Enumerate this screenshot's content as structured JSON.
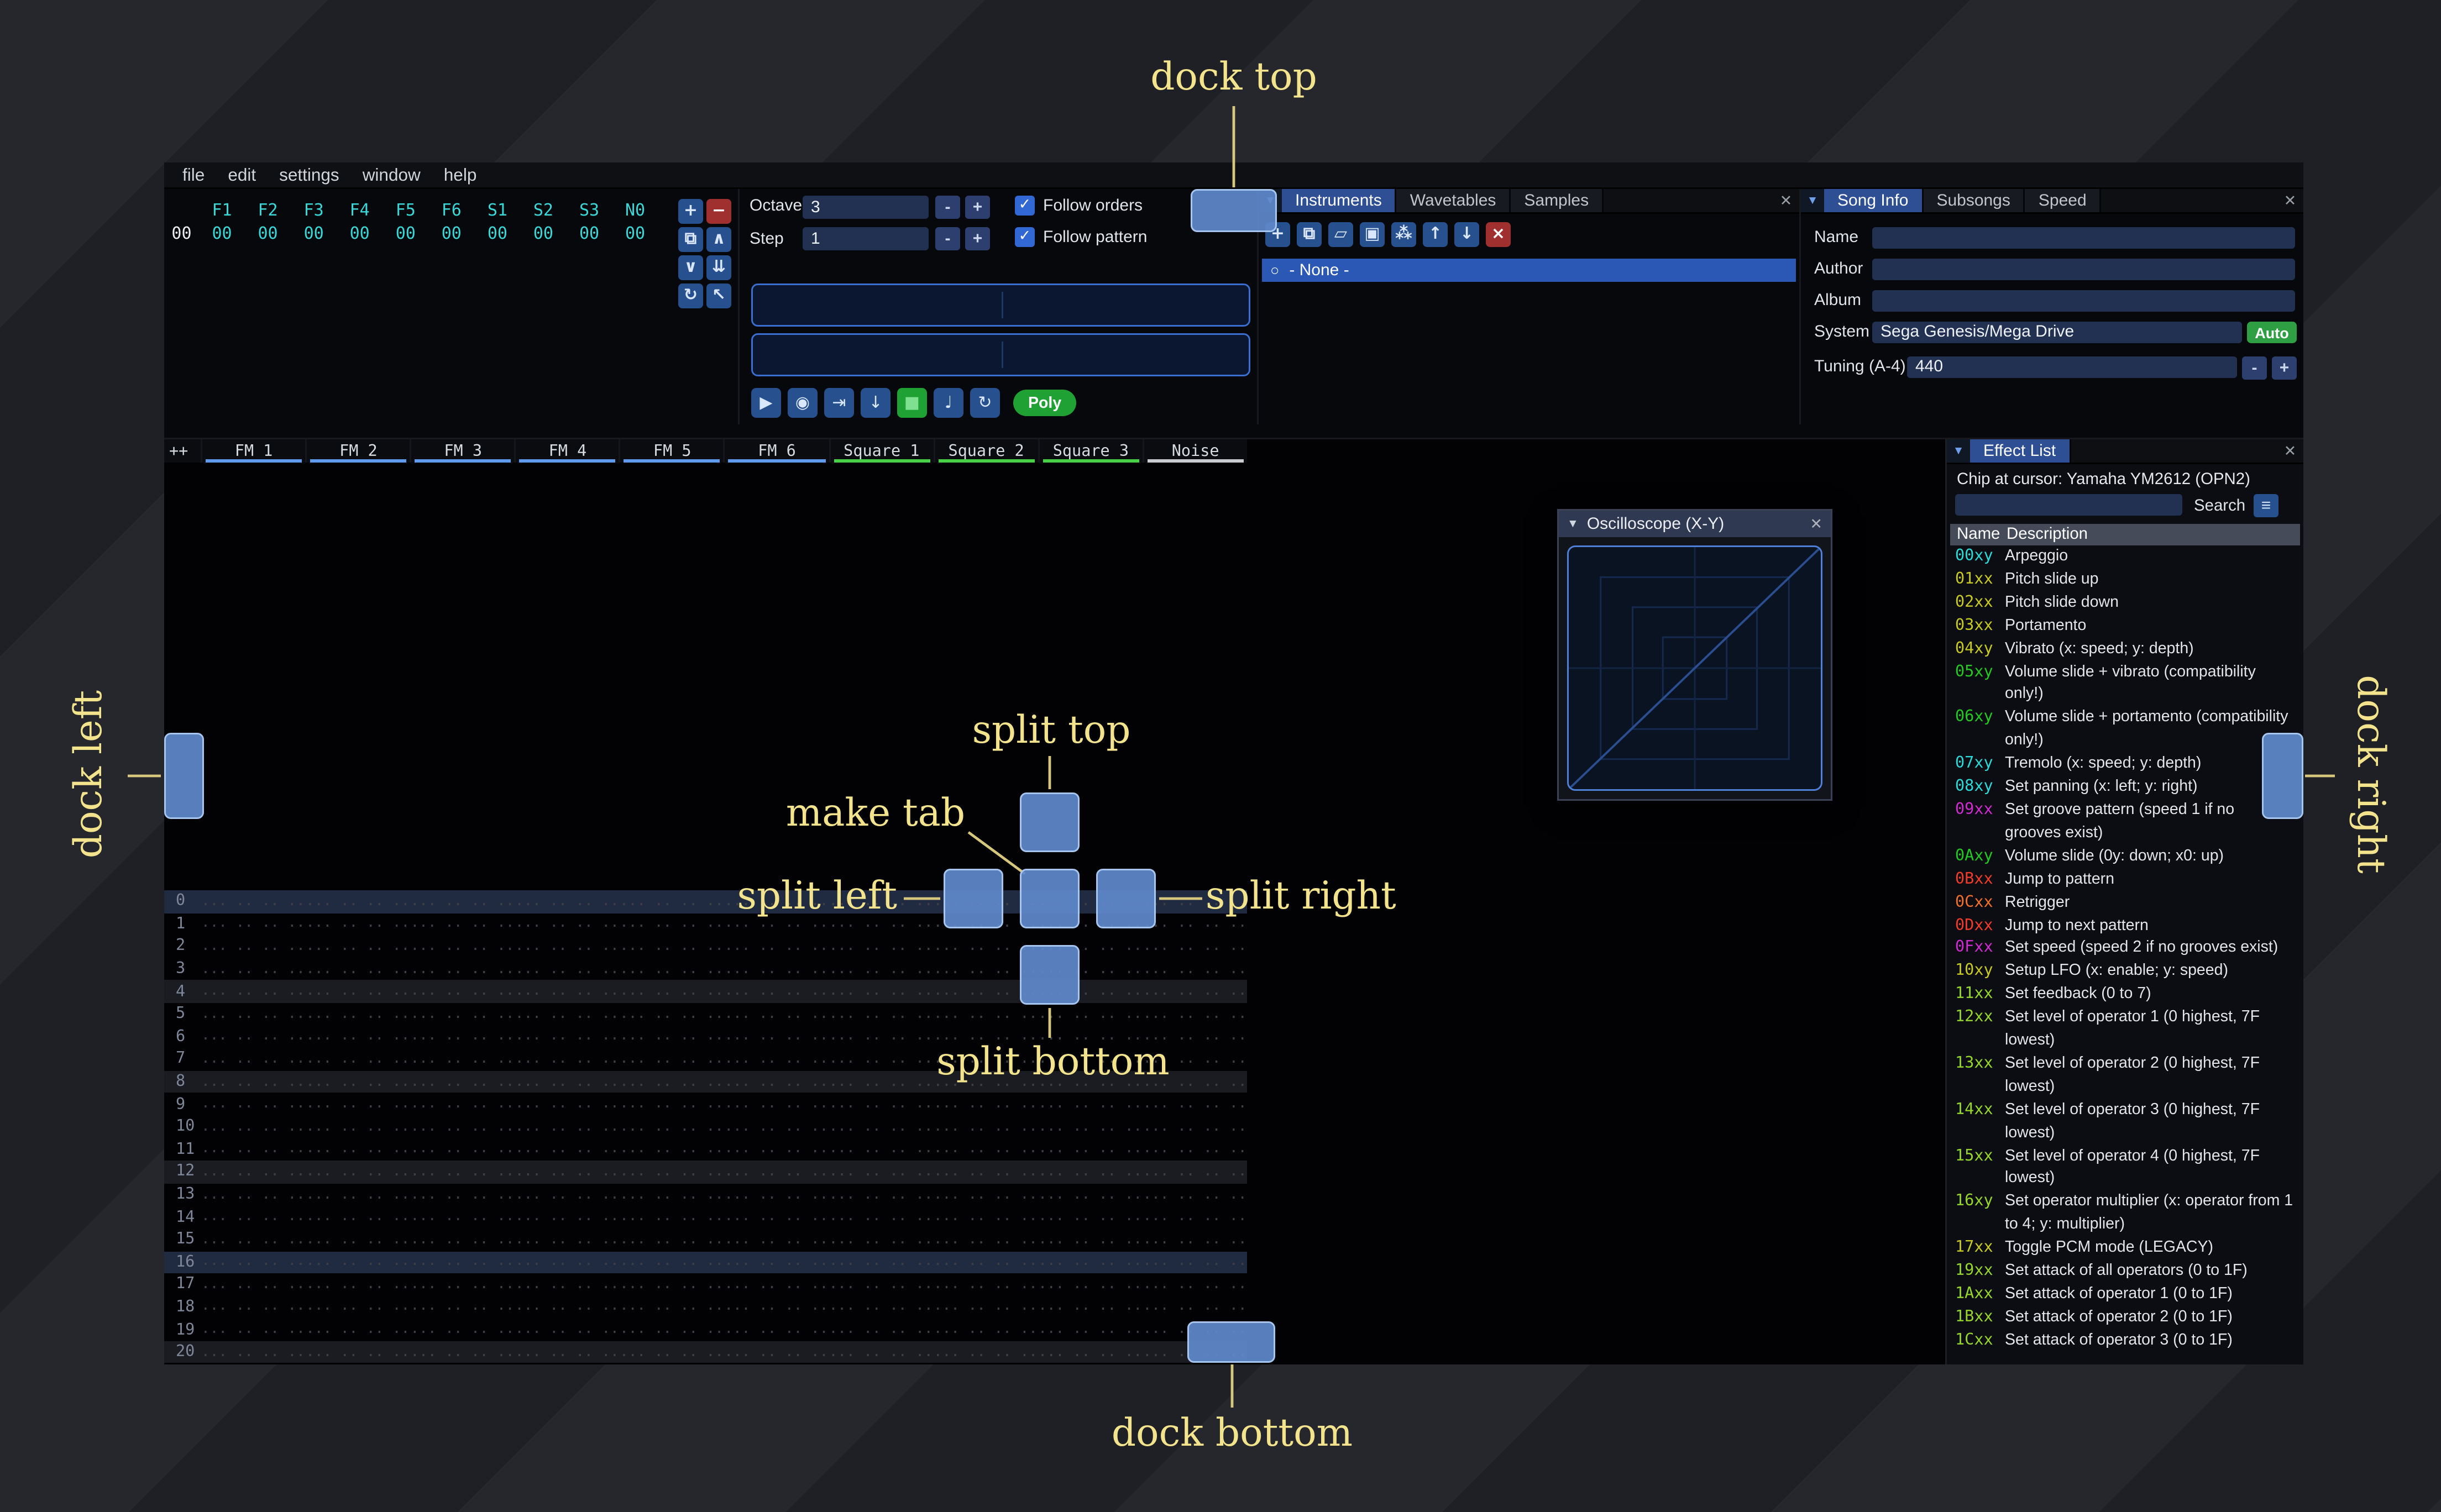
{
  "annotations": {
    "dock_top": "dock top",
    "dock_bottom": "dock bottom",
    "dock_left": "dock left",
    "dock_right": "dock right",
    "make_tab": "make tab",
    "split_top": "split top",
    "split_left": "split left",
    "split_right": "split right",
    "split_bottom": "split bottom"
  },
  "menu": {
    "items": [
      "file",
      "edit",
      "settings",
      "window",
      "help"
    ]
  },
  "orders": {
    "channels": [
      "F1",
      "F2",
      "F3",
      "F4",
      "F5",
      "F6",
      "S1",
      "S2",
      "S3",
      "N0"
    ],
    "row_index": "00",
    "row_values": [
      "00",
      "00",
      "00",
      "00",
      "00",
      "00",
      "00",
      "00",
      "00",
      "00"
    ],
    "buttons": [
      {
        "name": "order-add-button",
        "glyph": "+",
        "style": "blue"
      },
      {
        "name": "order-remove-button",
        "glyph": "−",
        "style": "red"
      },
      {
        "name": "order-duplicate-button",
        "glyph": "⧉",
        "style": "blue"
      },
      {
        "name": "order-move-up-button",
        "glyph": "∧",
        "style": "blue"
      },
      {
        "name": "order-move-down-button",
        "glyph": "∨",
        "style": "blue"
      },
      {
        "name": "order-duplicate-to-end-button",
        "glyph": "⇊",
        "style": "blue"
      },
      {
        "name": "order-change-mode-button",
        "glyph": "↻",
        "style": "blue"
      },
      {
        "name": "order-edit-mode-button",
        "glyph": "↖",
        "style": "blue"
      }
    ]
  },
  "playback": {
    "octave_label": "Octave",
    "octave_value": "3",
    "step_label": "Step",
    "step_value": "1",
    "minus": "-",
    "plus": "+",
    "check_glyph": "✓",
    "follow_orders_label": "Follow orders",
    "follow_pattern_label": "Follow pattern",
    "transport": [
      {
        "name": "play-button",
        "glyph": "▶",
        "style": "blue"
      },
      {
        "name": "play-pattern-button",
        "glyph": "◉",
        "style": "blue"
      },
      {
        "name": "play-from-cursor-button",
        "glyph": "⇥",
        "style": "blue"
      },
      {
        "name": "step-row-button",
        "glyph": "↓",
        "style": "blue"
      },
      {
        "name": "stop-button",
        "glyph": "■",
        "style": "green"
      },
      {
        "name": "metronome-button",
        "glyph": "♩",
        "style": "blue"
      },
      {
        "name": "repeat-button",
        "glyph": "↻",
        "style": "blue"
      }
    ],
    "poly_label": "Poly"
  },
  "assets": {
    "tabs": [
      "Instruments",
      "Wavetables",
      "Samples"
    ],
    "active_tab": "Instruments",
    "dropdown": "▼",
    "close": "✕",
    "radio": "○",
    "toolbar": [
      {
        "name": "instrument-add-button",
        "glyph": "+",
        "style": "blue"
      },
      {
        "name": "instrument-clone-button",
        "glyph": "⧉",
        "style": "blue"
      },
      {
        "name": "instrument-open-button",
        "glyph": "▱",
        "style": "blue"
      },
      {
        "name": "instrument-save-button",
        "glyph": "▣",
        "style": "blue"
      },
      {
        "name": "instrument-organize-button",
        "glyph": "⁂",
        "style": "blue"
      },
      {
        "name": "instrument-move-up-button",
        "glyph": "↑",
        "style": "blue"
      },
      {
        "name": "instrument-move-down-button",
        "glyph": "↓",
        "style": "blue"
      },
      {
        "name": "instrument-delete-button",
        "glyph": "×",
        "style": "red"
      }
    ],
    "list_item": "- None -"
  },
  "song_info": {
    "tabs": [
      "Song Info",
      "Subsongs",
      "Speed"
    ],
    "active_tab": "Song Info",
    "dropdown": "▼",
    "close": "✕",
    "fields": {
      "name_label": "Name",
      "name_value": "",
      "author_label": "Author",
      "author_value": "",
      "album_label": "Album",
      "album_value": "",
      "system_label": "System",
      "system_value": "Sega Genesis/Mega Drive",
      "auto_label": "Auto",
      "tuning_label": "Tuning (A-4)",
      "tuning_value": "440",
      "minus": "-",
      "plus": "+"
    }
  },
  "pattern": {
    "corner_label": "++",
    "channels": [
      {
        "name": "FM 1",
        "color": "#5e9bec"
      },
      {
        "name": "FM 2",
        "color": "#5e9bec"
      },
      {
        "name": "FM 3",
        "color": "#5e9bec"
      },
      {
        "name": "FM 4",
        "color": "#5e9bec"
      },
      {
        "name": "FM 5",
        "color": "#5e9bec"
      },
      {
        "name": "FM 6",
        "color": "#5e9bec"
      },
      {
        "name": "Square 1",
        "color": "#47d147"
      },
      {
        "name": "Square 2",
        "color": "#47d147"
      },
      {
        "name": "Square 3",
        "color": "#47d147"
      },
      {
        "name": "Noise",
        "color": "#c9ccd1"
      }
    ],
    "rows": 22,
    "empty_cell": "... .. .. ..",
    "strong_highlight_rows": [
      0,
      16
    ],
    "light_highlight_rows": [
      4,
      8,
      12,
      20
    ]
  },
  "oscilloscope": {
    "title": "Oscilloscope (X-Y)",
    "collapse": "▼",
    "close": "✕"
  },
  "effects": {
    "tab": "Effect List",
    "dropdown": "▼",
    "close": "✕",
    "chip_line": "Chip at cursor: Yamaha YM2612 (OPN2)",
    "search_label": "Search",
    "menu_glyph": "≡",
    "name_col": "Name",
    "desc_col": "Description",
    "entries": [
      {
        "name": "00xy",
        "color": "#2bd9d9",
        "desc": "Arpeggio"
      },
      {
        "name": "01xx",
        "color": "#c9c923",
        "desc": "Pitch slide up"
      },
      {
        "name": "02xx",
        "color": "#c9c923",
        "desc": "Pitch slide down"
      },
      {
        "name": "03xx",
        "color": "#c9c923",
        "desc": "Portamento"
      },
      {
        "name": "04xy",
        "color": "#c9c923",
        "desc": "Vibrato (x: speed; y: depth)"
      },
      {
        "name": "05xy",
        "color": "#23c923",
        "desc": "Volume slide + vibrato (compatibility only!)"
      },
      {
        "name": "06xy",
        "color": "#23c923",
        "desc": "Volume slide + portamento (compatibility only!)"
      },
      {
        "name": "07xy",
        "color": "#2bd9d9",
        "desc": "Tremolo (x: speed; y: depth)"
      },
      {
        "name": "08xy",
        "color": "#2bd9d9",
        "desc": "Set panning (x: left; y: right)"
      },
      {
        "name": "09xx",
        "color": "#d02bd0",
        "desc": "Set groove pattern (speed 1 if no grooves exist)"
      },
      {
        "name": "0Axy",
        "color": "#23c923",
        "desc": "Volume slide (0y: down; x0: up)"
      },
      {
        "name": "0Bxx",
        "color": "#f23b28",
        "desc": "Jump to pattern"
      },
      {
        "name": "0Cxx",
        "color": "#f2702b",
        "desc": "Retrigger"
      },
      {
        "name": "0Dxx",
        "color": "#f23b28",
        "desc": "Jump to next pattern"
      },
      {
        "name": "0Fxx",
        "color": "#d02bd0",
        "desc": "Set speed (speed 2 if no grooves exist)"
      },
      {
        "name": "10xy",
        "color": "#c9c923",
        "desc": "Setup LFO (x: enable; y: speed)"
      },
      {
        "name": "11xx",
        "color": "#96d62b",
        "desc": "Set feedback (0 to 7)"
      },
      {
        "name": "12xx",
        "color": "#96d62b",
        "desc": "Set level of operator 1 (0 highest, 7F lowest)"
      },
      {
        "name": "13xx",
        "color": "#96d62b",
        "desc": "Set level of operator 2 (0 highest, 7F lowest)"
      },
      {
        "name": "14xx",
        "color": "#96d62b",
        "desc": "Set level of operator 3 (0 highest, 7F lowest)"
      },
      {
        "name": "15xx",
        "color": "#96d62b",
        "desc": "Set level of operator 4 (0 highest, 7F lowest)"
      },
      {
        "name": "16xy",
        "color": "#96d62b",
        "desc": "Set operator multiplier (x: operator from 1 to 4; y: multiplier)"
      },
      {
        "name": "17xx",
        "color": "#c9c923",
        "desc": "Toggle PCM mode (LEGACY)"
      },
      {
        "name": "19xx",
        "color": "#96d62b",
        "desc": "Set attack of all operators (0 to 1F)"
      },
      {
        "name": "1Axx",
        "color": "#96d62b",
        "desc": "Set attack of operator 1 (0 to 1F)"
      },
      {
        "name": "1Bxx",
        "color": "#96d62b",
        "desc": "Set attack of operator 2 (0 to 1F)"
      },
      {
        "name": "1Cxx",
        "color": "#96d62b",
        "desc": "Set attack of operator 3 (0 to 1F)"
      }
    ]
  }
}
